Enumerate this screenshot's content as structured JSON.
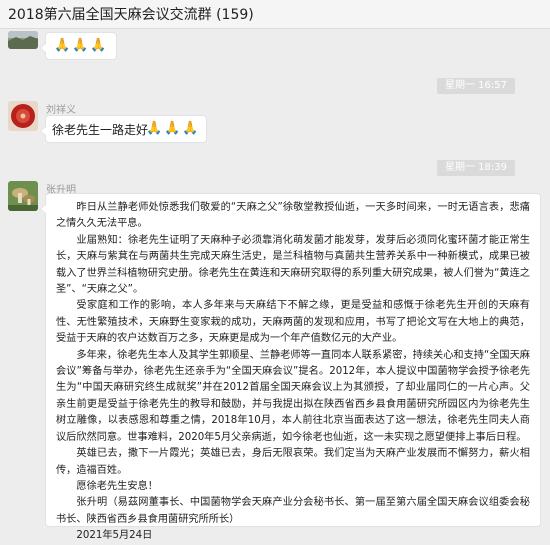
{
  "window": {
    "title": "2018第六届全国天麻会议交流群 (159)"
  },
  "messages": [
    {
      "sender": "",
      "avatar": "avatar-landscape",
      "content": "🙏🙏🙏"
    },
    {
      "timestamp": "星期一 16:57",
      "sender": "刘祥义",
      "avatar": "avatar-red-circle",
      "content": "徐老先生一路走好",
      "emoji": "🙏🙏🙏"
    },
    {
      "timestamp": "星期一 18:39",
      "sender": "张升明",
      "avatar": "avatar-green-mushroom",
      "paragraphs": [
        "昨日从兰静老师处惊悉我们敬爱的“天麻之父”徐敬堂教授仙逝，一天多时间来，一时无语言表，悲痛之情久久无法平息。",
        "业届熟知：徐老先生证明了天麻种子必须靠消化萌发菌才能发芽，发芽后必须同化蜜环菌才能正常生长，天麻与紫萁在与两菌共生完成天麻生活史，是兰科植物与真菌共生营养关系中一种新模式，成果已被载入了世界兰科植物研究史册。徐老先生在黄连和天麻研究取得的系列重大研究成果，被人们誉为“黄连之圣”、“天麻之父”。",
        "受家庭和工作的影响，本人多年来与天麻结下不解之缘，更是受益和感慨于徐老先生开创的天麻有性、无性繁殖技术，天麻野生变家栽的成功，天麻两菌的发现和应用，书写了把论文写在大地上的典范，受益于天麻的农户达数百万之多，天麻更是成为一个年产值数亿元的大产业。",
        "多年来，徐老先生本人及其学生郭顺星、兰静老师等一直同本人联系紧密，持续关心和支持“全国天麻会议”筹备与举办，徐老先生还亲手为“全国天麻会议”提名。2012年，本人提议中国菌物学会授予徐老先生为“中国天麻研究终生成就奖”并在2012首届全国天麻会议上为其颁授，了却业届同仁的一片心声。父亲生前更是受益于徐老先生的教导和鼓励，并与我提出拟在陕西省西乡县食用菌研究所园区内为徐老先生树立雕像，以表感恩和尊重之情，2018年10月，本人前往北京当面表达了这一想法，徐老先生同夫人商议后欣然同意。世事难料，2020年5月父亲病逝，如今徐老也仙逝，这一未实现之愿望便排上事后日程。",
        "英雄已去，撒下一片霞光；英雄已去，身后无限哀荣。我们定当为天麻产业发展而不懈努力，薪火相传，造福百姓。",
        "愿徐老先生安息！",
        "张升明（易茲网董事长、中国菌物学会天麻产业分会秘书长、第一届至第六届全国天麻会议组委会秘书长、陕西省西乡县食用菌研究所所长）",
        "2021年5月24日"
      ]
    }
  ]
}
